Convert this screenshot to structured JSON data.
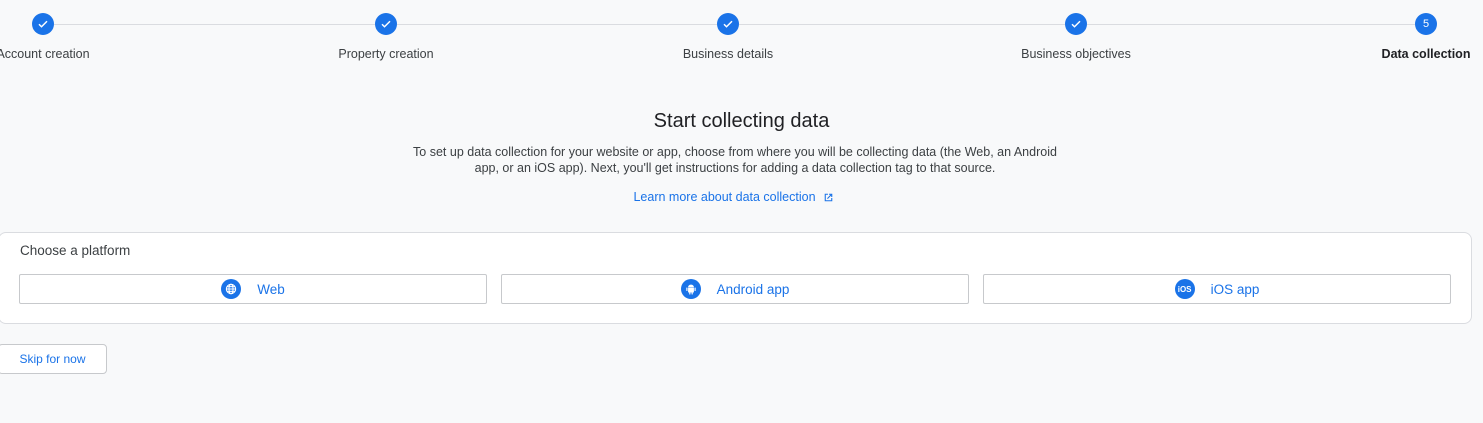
{
  "stepper": {
    "steps": [
      {
        "label": "Account creation",
        "status": "done"
      },
      {
        "label": "Property creation",
        "status": "done"
      },
      {
        "label": "Business details",
        "status": "done"
      },
      {
        "label": "Business objectives",
        "status": "done"
      },
      {
        "label": "Data collection",
        "status": "active",
        "number": "5"
      }
    ]
  },
  "main": {
    "title": "Start collecting data",
    "description": "To set up data collection for your website or app, choose from where you will be collecting data (the Web, an Android app, or an iOS app). Next, you'll get instructions for adding a data collection tag to that source.",
    "learn_more": "Learn more about data collection"
  },
  "platform": {
    "title": "Choose a platform",
    "options": [
      {
        "label": "Web",
        "icon": "globe-icon"
      },
      {
        "label": "Android app",
        "icon": "android-icon"
      },
      {
        "label": "iOS app",
        "icon": "ios-icon",
        "icon_text": "iOS"
      }
    ]
  },
  "footer": {
    "skip_label": "Skip for now"
  },
  "colors": {
    "accent": "#1a73e8",
    "background": "#f8f9fa",
    "border": "#dadce0"
  }
}
